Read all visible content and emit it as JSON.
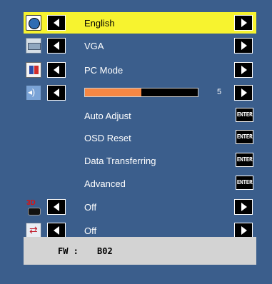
{
  "menu": {
    "rows": [
      {
        "type": "select",
        "icon": "globe-icon",
        "label": "English",
        "selected": true
      },
      {
        "type": "select",
        "icon": "vga-icon",
        "label": "VGA",
        "selected": false
      },
      {
        "type": "select",
        "icon": "pc-mode-icon",
        "label": "PC Mode",
        "selected": false
      },
      {
        "type": "slider",
        "icon": "speaker-icon",
        "value": 5,
        "fill_fraction": 0.5,
        "selected": false
      },
      {
        "type": "enter",
        "label": "Auto Adjust",
        "button": "ENTER"
      },
      {
        "type": "enter",
        "label": "OSD Reset",
        "button": "ENTER"
      },
      {
        "type": "enter",
        "label": "Data Transferring",
        "button": "ENTER"
      },
      {
        "type": "enter",
        "label": "Advanced",
        "button": "ENTER"
      },
      {
        "type": "select",
        "icon": "3d-glasses-icon",
        "label": "Off",
        "selected": false
      },
      {
        "type": "select",
        "icon": "swap-icon",
        "label": "Off",
        "selected": false
      }
    ]
  },
  "footer": {
    "fw_label": "FW :",
    "fw_value": "B02"
  },
  "colors": {
    "background": "#3b5e8c",
    "highlight": "#f7f32f",
    "slider_fill": "#f68743",
    "footer_bg": "#d3d3d3"
  }
}
